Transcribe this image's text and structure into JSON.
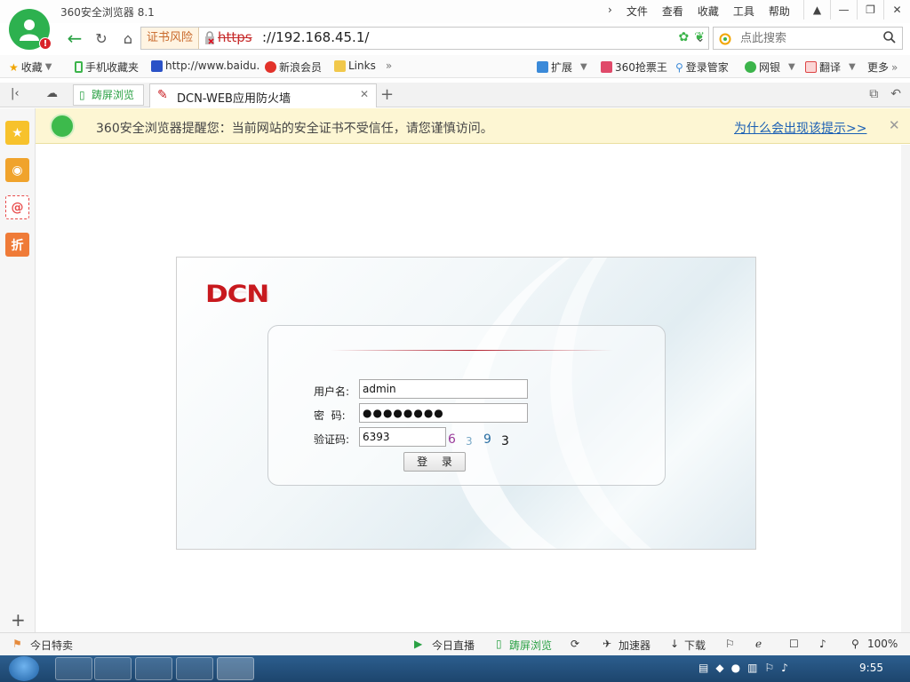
{
  "app": {
    "title": "360安全浏览器 8.1"
  },
  "top_menu": [
    "文件",
    "查看",
    "收藏",
    "工具",
    "帮助"
  ],
  "address": {
    "cert_warning": "证书风险",
    "url_scheme": "https",
    "url_rest": "://192.168.45.1/"
  },
  "search": {
    "placeholder": "点此搜索"
  },
  "bookmarks": {
    "favorites": "收藏",
    "mobile": "手机收藏夹",
    "baidu": "http://www.baidu.",
    "sina": "新浪会员",
    "links": "Links",
    "extensions": "扩展",
    "ticket": "360抢票王",
    "login_manager": "登录管家",
    "bank": "网银",
    "translate": "翻译",
    "more": "更多"
  },
  "tabs": {
    "split": "踌屏浏览",
    "active": "DCN-WEB应用防火墙"
  },
  "notification": {
    "text": "360安全浏览器提醒您：当前网站的安全证书不受信任，请您谨慎访问。",
    "link": "为什么会出现该提示>>"
  },
  "login": {
    "brand": "DCN",
    "username_label": "用户名:",
    "username_value": "admin",
    "password_label": "密  码:",
    "password_value": "●●●●●●●●",
    "captcha_label": "验证码:",
    "captcha_value": "6393",
    "captcha_image": [
      "6",
      "3",
      "9",
      "3"
    ],
    "submit": "登 录"
  },
  "statusbar": {
    "today": "今日特卖",
    "live": "今日直播",
    "split": "踌屏浏览",
    "accelerate": "加速器",
    "download": "下载",
    "zoom": "100%"
  },
  "taskbar": {
    "time": "9:55"
  }
}
